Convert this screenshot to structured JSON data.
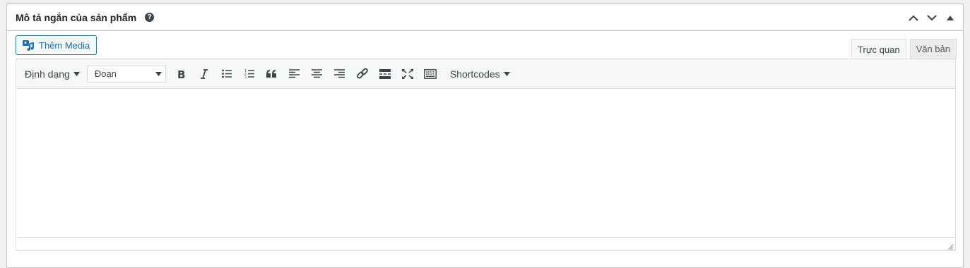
{
  "metabox": {
    "title": "Mô tả ngắn của sản phẩm",
    "help_icon": "?"
  },
  "media_button": {
    "label": "Thêm Media",
    "icon": "media-icon"
  },
  "tabs": [
    {
      "label": "Trực quan",
      "active": true
    },
    {
      "label": "Văn bản",
      "active": false
    }
  ],
  "toolbar": {
    "format_menu": "Định dạng",
    "block_select": "Đoạn",
    "shortcodes": "Shortcodes",
    "buttons": [
      "bold",
      "italic",
      "bulleted-list",
      "numbered-list",
      "blockquote",
      "align-left",
      "align-center",
      "align-right",
      "link",
      "read-more",
      "fullscreen",
      "toolbar-toggle"
    ]
  },
  "colors": {
    "accent": "#2271b1",
    "border": "#c3c4c7",
    "toolbar_bg": "#f6f7f7",
    "icon": "#3c434a"
  }
}
